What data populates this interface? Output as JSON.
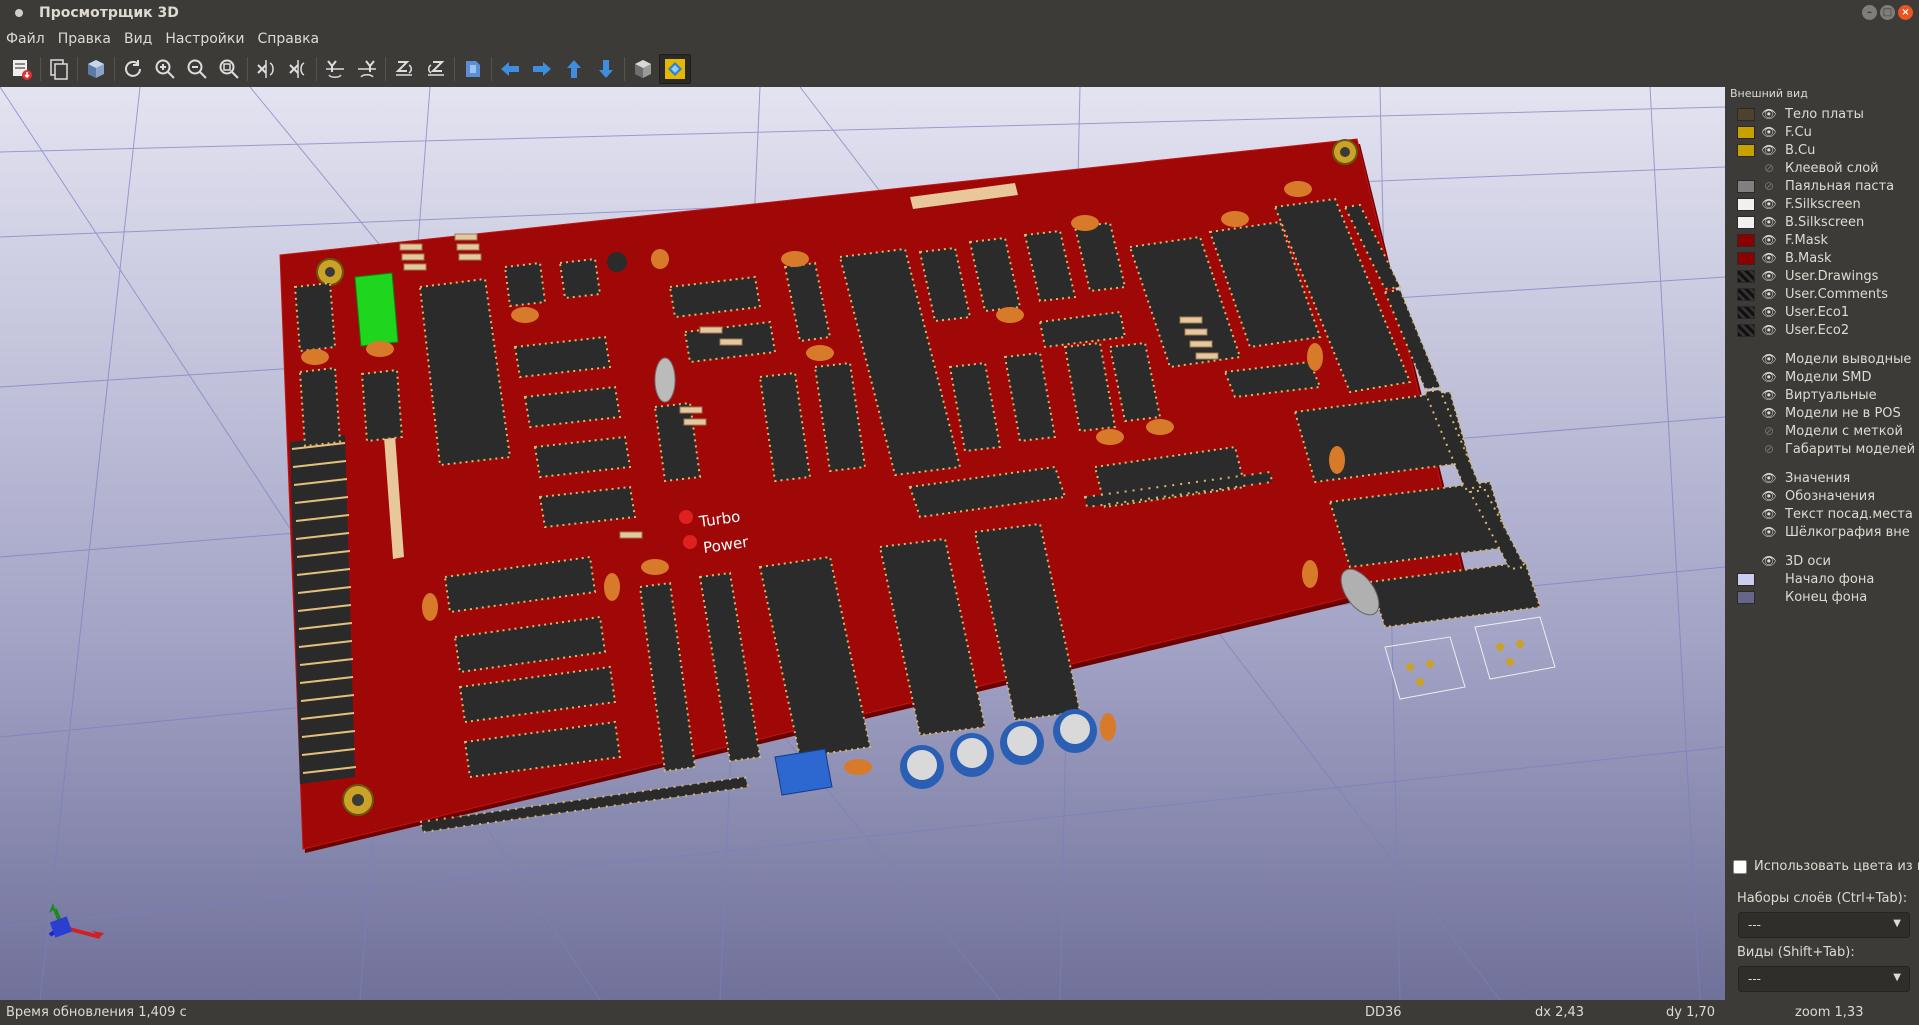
{
  "window": {
    "title": "Просмотрщик 3D",
    "buttons": {
      "minimize": "–",
      "maximize": "□",
      "close": "×"
    }
  },
  "menu": [
    "Файл",
    "Правка",
    "Вид",
    "Настройки",
    "Справка"
  ],
  "toolbar": {
    "icons": [
      "export-icon",
      "copy-icon",
      "board-icon",
      "reload-icon",
      "zoom-in-icon",
      "zoom-out-icon",
      "zoom-fit-icon",
      "rotate-x-icon",
      "rotate-x-ccw-icon",
      "rotate-y-icon",
      "rotate-y-ccw-icon",
      "rotate-z-icon",
      "rotate-z-ccw-icon",
      "flip-icon",
      "pan-left-icon",
      "pan-right-icon",
      "pan-up-icon",
      "pan-down-icon",
      "ortho-icon",
      "raytrace-icon"
    ]
  },
  "board": {
    "labels": {
      "turbo": "Turbo",
      "power": "Power"
    }
  },
  "panel": {
    "header": "Внешний вид",
    "layers": [
      {
        "label": "Тело платы",
        "color": "#4e4130",
        "eye": "on"
      },
      {
        "label": "F.Cu",
        "color": "#c8a000",
        "eye": "on"
      },
      {
        "label": "B.Cu",
        "color": "#c8a000",
        "eye": "on"
      },
      {
        "label": "Клеевой слой",
        "color": "",
        "eye": "off"
      },
      {
        "label": "Паяльная паста",
        "color": "#808080",
        "eye": "off"
      },
      {
        "label": "F.Silkscreen",
        "color": "#f0f0f0",
        "eye": "on"
      },
      {
        "label": "B.Silkscreen",
        "color": "#f0f0f0",
        "eye": "on"
      },
      {
        "label": "F.Mask",
        "color": "#8b0000",
        "eye": "on"
      },
      {
        "label": "B.Mask",
        "color": "#8b0000",
        "eye": "on"
      },
      {
        "label": "User.Drawings",
        "color": "checker",
        "eye": "on"
      },
      {
        "label": "User.Comments",
        "color": "checker",
        "eye": "on"
      },
      {
        "label": "User.Eco1",
        "color": "checker",
        "eye": "on"
      },
      {
        "label": "User.Eco2",
        "color": "checker",
        "eye": "on"
      }
    ],
    "models": [
      {
        "label": "Модели выводные",
        "eye": "on"
      },
      {
        "label": "Модели SMD",
        "eye": "on"
      },
      {
        "label": "Виртуальные",
        "eye": "on"
      },
      {
        "label": "Модели не в POS",
        "eye": "on"
      },
      {
        "label": "Модели с меткой",
        "eye": "off"
      },
      {
        "label": "Габариты моделей",
        "eye": "off"
      }
    ],
    "text_items": [
      {
        "label": "Значения",
        "eye": "on"
      },
      {
        "label": "Обозначения",
        "eye": "on"
      },
      {
        "label": "Текст посад.места",
        "eye": "on"
      },
      {
        "label": "Шёлкография вне",
        "eye": "on"
      }
    ],
    "background": [
      {
        "label": "3D оси",
        "color": "",
        "eye": "on"
      },
      {
        "label": "Начало фона",
        "color": "#ccccee",
        "eye": ""
      },
      {
        "label": "Конец фона",
        "color": "#66668a",
        "eye": ""
      }
    ],
    "use_colors_label": "Использовать цвета из н",
    "layer_presets_label": "Наборы слоёв (Ctrl+Tab):",
    "layer_presets_value": "---",
    "views_label": "Виды (Shift+Tab):",
    "views_value": "---"
  },
  "status": {
    "render_time": "Время обновления 1,409 с",
    "selected": "DD36",
    "dx": "dx 2,43",
    "dy": "dy 1,70",
    "zoom": "zoom 1,33"
  }
}
